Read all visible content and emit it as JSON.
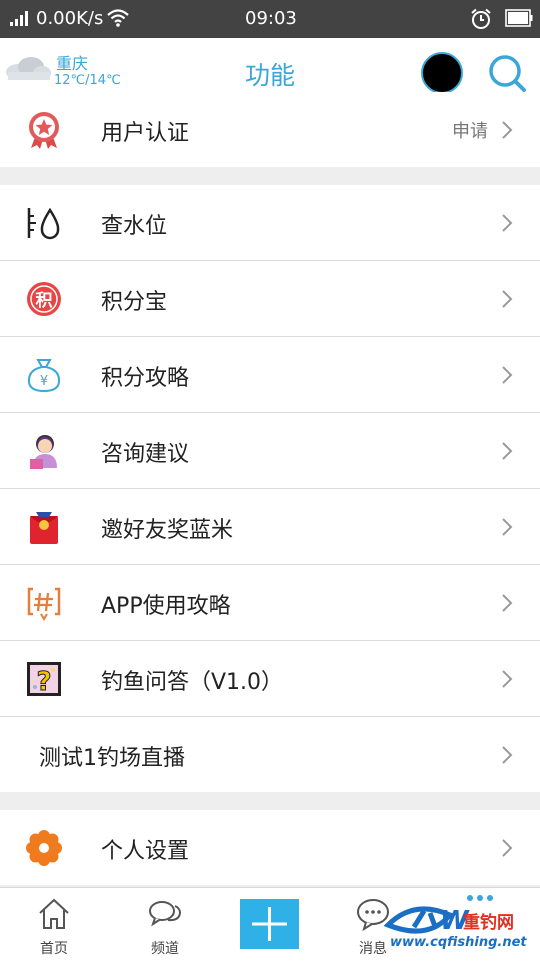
{
  "status_bar": {
    "speed": "0.00K/s",
    "time": "09:03"
  },
  "header": {
    "city": "重庆",
    "temperature": "12℃/14℃",
    "title": "功能"
  },
  "groups": [
    [
      {
        "name": "user-verification",
        "icon": "award-star-icon",
        "label": "用户认证",
        "right_text": "申请"
      }
    ],
    [
      {
        "name": "check-water-level",
        "icon": "water-level-icon",
        "label": "查水位"
      },
      {
        "name": "points-treasure",
        "icon": "points-badge-icon",
        "label": "积分宝"
      },
      {
        "name": "points-guide",
        "icon": "money-bag-icon",
        "label": "积分攻略"
      },
      {
        "name": "consult-suggest",
        "icon": "customer-service-icon",
        "label": "咨询建议"
      },
      {
        "name": "invite-friends",
        "icon": "red-envelope-icon",
        "label": "邀好友奖蓝米"
      },
      {
        "name": "app-guide",
        "icon": "hashtag-icon",
        "label": "APP使用攻略"
      },
      {
        "name": "fishing-qa",
        "icon": "question-icon",
        "label": "钓鱼问答（V1.0）"
      },
      {
        "name": "test-live",
        "icon": "",
        "label": "测试1钓场直播"
      }
    ],
    [
      {
        "name": "personal-settings",
        "icon": "settings-flower-icon",
        "label": "个人设置"
      }
    ]
  ],
  "tabs": [
    {
      "name": "home",
      "label": "首页",
      "icon": "home-icon"
    },
    {
      "name": "channel",
      "label": "频道",
      "icon": "chat-bubbles-icon"
    },
    {
      "name": "add",
      "label": "",
      "icon": "plus-icon"
    },
    {
      "name": "messages",
      "label": "消息",
      "icon": "message-icon"
    }
  ],
  "watermark": {
    "brand": "重钓网",
    "url": "www.cqfishing.net"
  },
  "colors": {
    "accent": "#3ba6d8",
    "status_bar": "#434343",
    "add_button": "#2fb1e8"
  }
}
